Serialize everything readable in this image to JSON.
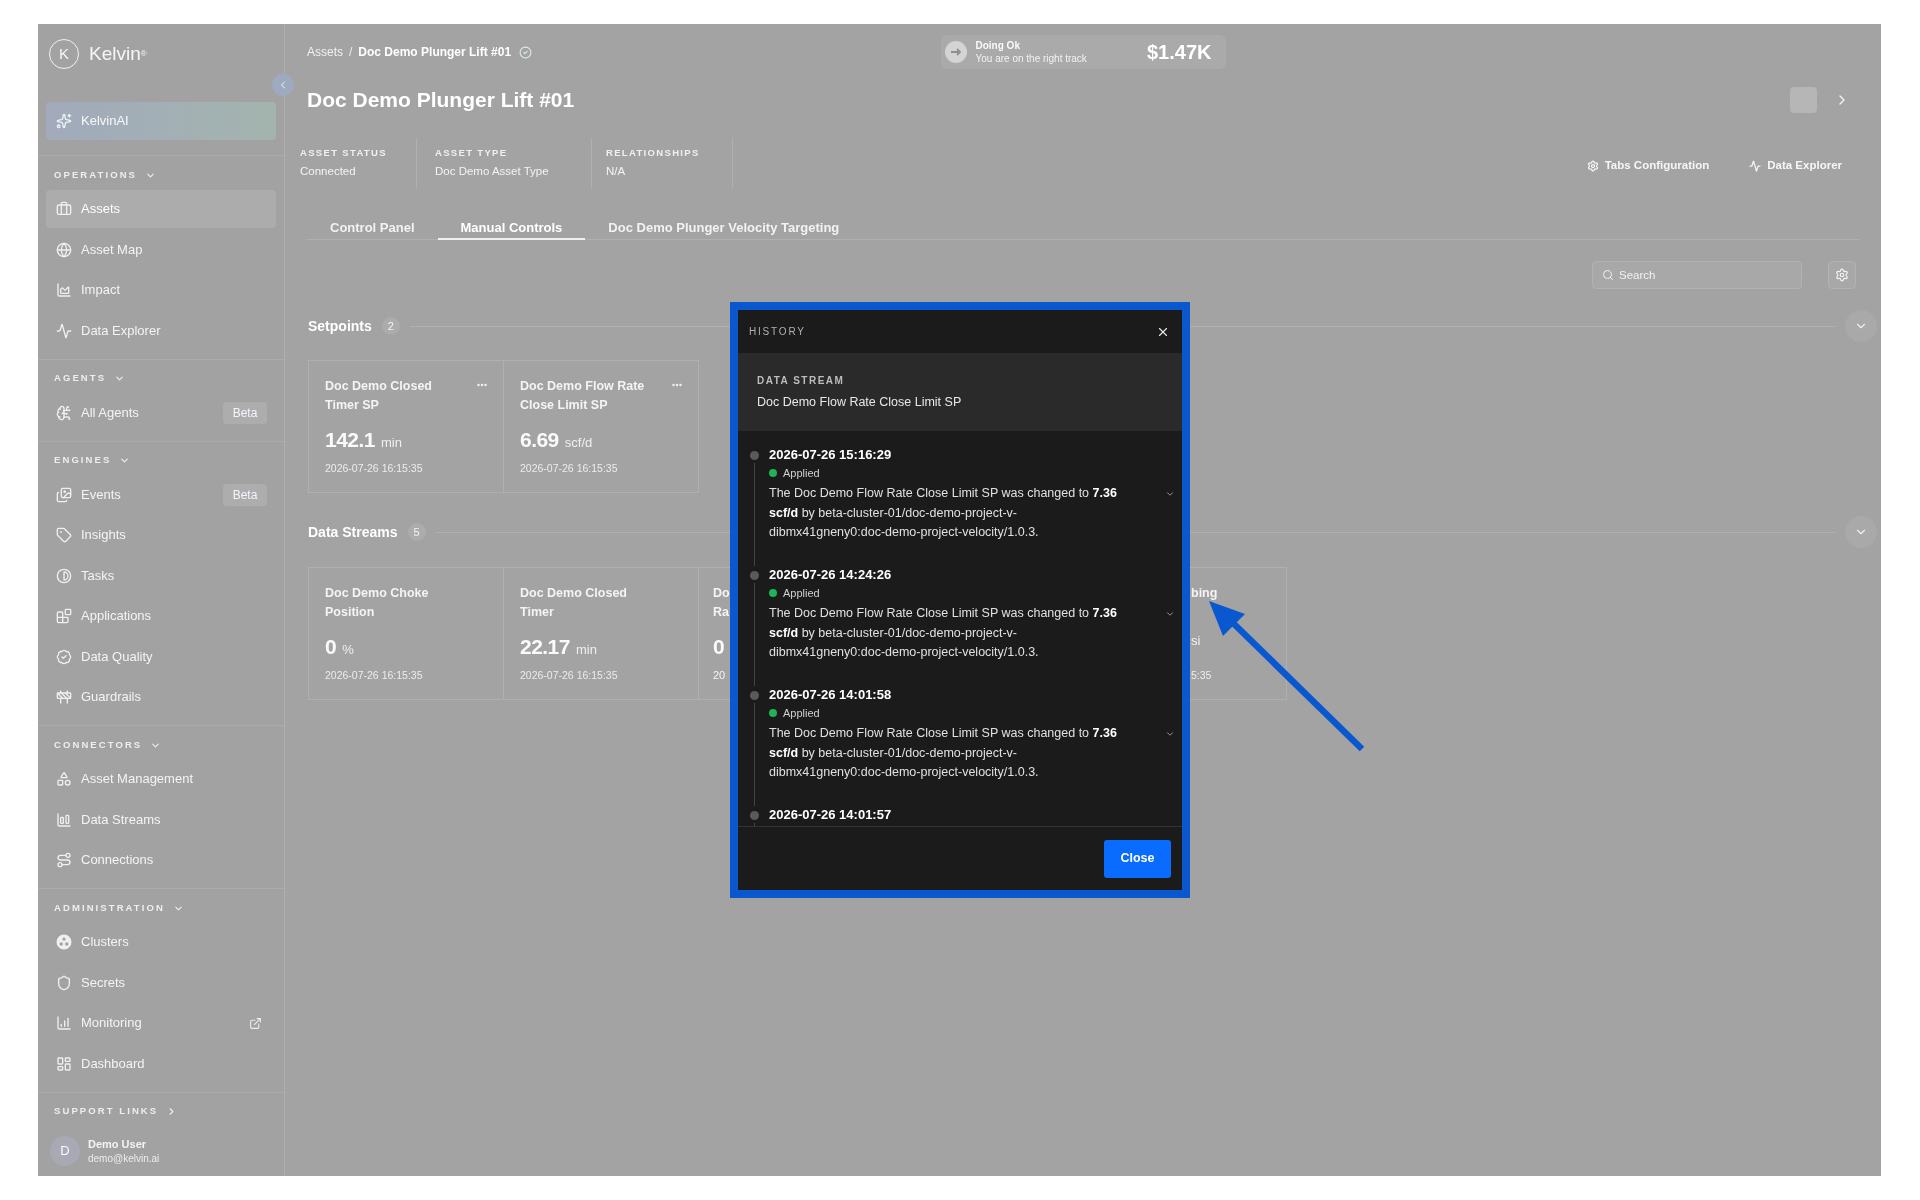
{
  "sidebar": {
    "logo_letter": "K",
    "logo_text": "Kelvin$^{®}$",
    "ai_button": "KelvinAI",
    "sections": [
      {
        "title": "OPERATIONS",
        "expanded": true,
        "items": [
          {
            "label": "Assets",
            "selected": true,
            "external": false
          },
          {
            "label": "Asset Map",
            "selected": false,
            "external": false
          },
          {
            "label": "Impact",
            "selected": false,
            "external": false
          },
          {
            "label": "Data Explorer",
            "selected": false,
            "external": false
          }
        ]
      },
      {
        "title": "AGENTS",
        "expanded": true,
        "items": [
          {
            "label": "All Agents",
            "selected": false,
            "external": false,
            "badge": "Beta"
          }
        ]
      },
      {
        "title": "ENGINES",
        "expanded": true,
        "items": [
          {
            "label": "Events",
            "selected": false,
            "external": false,
            "badge": "Beta"
          },
          {
            "label": "Insights",
            "selected": false,
            "external": false
          },
          {
            "label": "Tasks",
            "selected": false,
            "external": false
          },
          {
            "label": "Applications",
            "selected": false,
            "external": false
          },
          {
            "label": "Data Quality",
            "selected": false,
            "external": false
          },
          {
            "label": "Guardrails",
            "selected": false,
            "external": false
          }
        ]
      },
      {
        "title": "CONNECTORS",
        "expanded": true,
        "items": [
          {
            "label": "Asset Management",
            "selected": false,
            "external": false
          },
          {
            "label": "Data Streams",
            "selected": false,
            "external": false
          },
          {
            "label": "Connections",
            "selected": false,
            "external": false
          }
        ]
      },
      {
        "title": "ADMINISTRATION",
        "expanded": true,
        "items": [
          {
            "label": "Clusters",
            "selected": false,
            "external": false
          },
          {
            "label": "Secrets",
            "selected": false,
            "external": false
          },
          {
            "label": "Monitoring",
            "selected": false,
            "external": true
          },
          {
            "label": "Dashboard",
            "selected": false,
            "external": false
          }
        ]
      },
      {
        "title": "SUPPORT LINKS",
        "expanded": false
      }
    ],
    "user": {
      "initial": "D",
      "name": "Demo User",
      "email": "demo@kelvin.ai"
    }
  },
  "breadcrumb": {
    "items": [
      "Assets",
      "Doc Demo Plunger Lift #01"
    ],
    "separator": "/"
  },
  "status_widget": {
    "title": "Doing Ok",
    "subtitle": "You are on the right track",
    "amount": "$1.47K"
  },
  "page_title": "Doc Demo Plunger Lift #01",
  "asset_info": [
    {
      "label": "ASSET STATUS",
      "value": "Connected"
    },
    {
      "label": "ASSET TYPE",
      "value": "Doc Demo Asset Type"
    },
    {
      "label": "RELATIONSHIPS",
      "value": "N/A"
    }
  ],
  "header_actions": [
    {
      "label": "Tabs Configuration"
    },
    {
      "label": "Data Explorer"
    }
  ],
  "tabs": [
    {
      "label": "Control Panel",
      "selected": false
    },
    {
      "label": "Manual Controls",
      "selected": true
    },
    {
      "label": "Doc Demo Plunger Velocity Targeting",
      "selected": false
    }
  ],
  "search": {
    "placeholder": "Search"
  },
  "content_sections": [
    {
      "title": "Setpoints",
      "count": "2",
      "expanded": true,
      "cards": [
        {
          "kind": "setpoint",
          "title": "Doc Demo Closed Timer SP",
          "value": "142.1",
          "unit": "min",
          "timestamp": "2026-07-26 16:15:35"
        },
        {
          "kind": "setpoint",
          "title": "Doc Demo Flow Rate Close Limit SP",
          "value": "6.69",
          "unit": "scf/d",
          "timestamp": "2026-07-26 16:15:35"
        }
      ]
    },
    {
      "title": "Data Streams",
      "count": "5",
      "expanded": true,
      "cards": [
        {
          "kind": "stream",
          "title": "Doc Demo Choke Position",
          "value": "0",
          "unit": "%",
          "timestamp": "2026-07-26 16:15:35"
        },
        {
          "kind": "stream",
          "title": "Doc Demo Closed Timer",
          "value": "22.17",
          "unit": "min",
          "timestamp": "2026-07-26 16:15:35"
        },
        {
          "kind": "leftpart",
          "title_lines": [
            "Do",
            "Ra"
          ],
          "value": "0",
          "timestamp": "20"
        },
        {
          "kind": "rightpart",
          "title_lines": [
            "bing"
          ],
          "unit": "si",
          "timestamp": "5:35"
        }
      ]
    }
  ],
  "history_dialog": {
    "title": "HISTORY",
    "stream_label": "DATA STREAM",
    "stream_name": "Doc Demo Flow Rate Close Limit SP",
    "entries": [
      {
        "timestamp": "2026-07-26 15:16:29",
        "status": "Applied",
        "color": "#1fb257",
        "description": "The Doc Demo Flow Rate Close Limit SP was changed to **7.36 scf/d** by beta-cluster-01/doc-demo-project-v-dibmx41gneny0:doc-demo-project-velocity/1.0.3."
      },
      {
        "timestamp": "2026-07-26 14:24:26",
        "status": "Applied",
        "color": "#1fb257",
        "description": "The Doc Demo Flow Rate Close Limit SP was changed to **7.36 scf/d** by beta-cluster-01/doc-demo-project-v-dibmx41gneny0:doc-demo-project-velocity/1.0.3."
      },
      {
        "timestamp": "2026-07-26 14:01:58",
        "status": "Applied",
        "color": "#1fb257",
        "description": "The Doc Demo Flow Rate Close Limit SP was changed to **7.36 scf/d** by beta-cluster-01/doc-demo-project-v-dibmx41gneny0:doc-demo-project-velocity/1.0.3."
      },
      {
        "timestamp": "2026-07-26 14:01:57"
      }
    ],
    "close_button": "Close"
  }
}
